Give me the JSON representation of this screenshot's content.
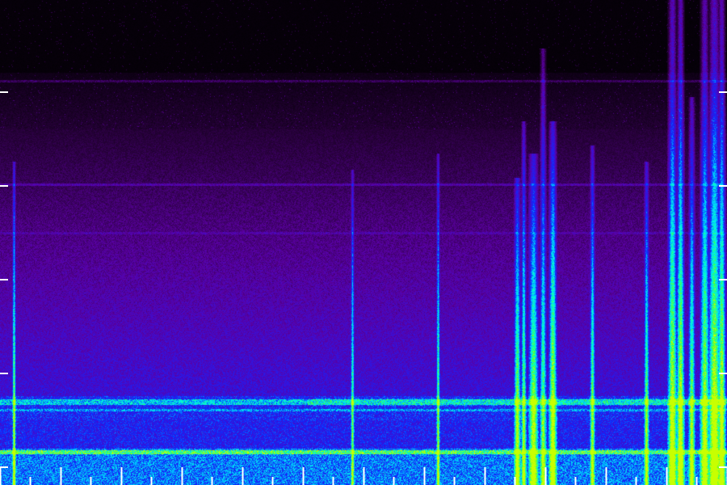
{
  "view": {
    "type": "spectrogram",
    "colormap": [
      "#000000",
      "#2a003f",
      "#5a00a0",
      "#3a10d8",
      "#0a2cff",
      "#00c8ff",
      "#00ffd8",
      "#40ff40",
      "#c8ff00"
    ],
    "tick_color": "#ffffff"
  }
}
